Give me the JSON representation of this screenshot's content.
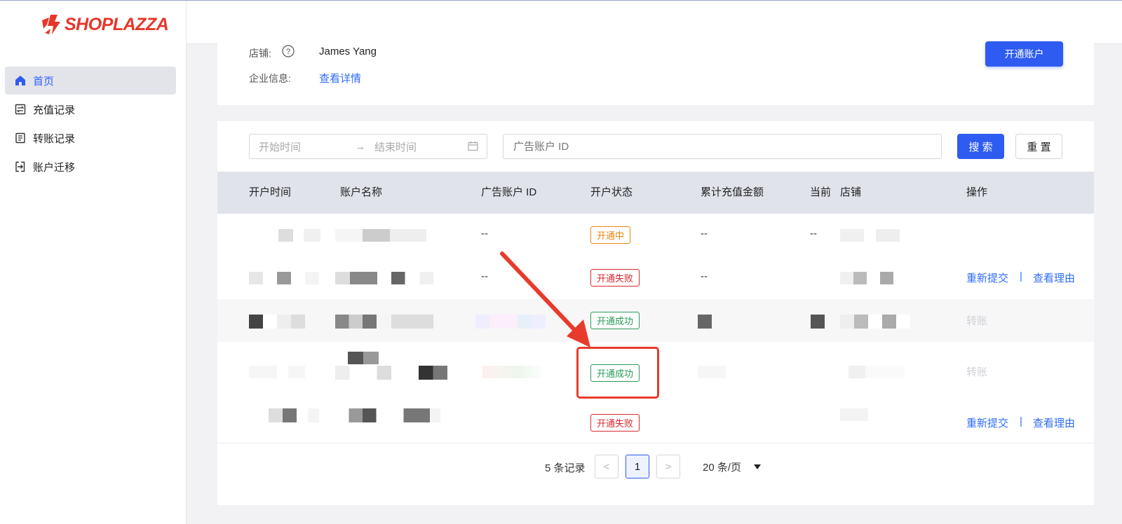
{
  "brand": {
    "name": "SHOPLAZZA",
    "color": "#e8362a"
  },
  "sidebar": {
    "items": [
      {
        "label": "首页",
        "icon": "home-icon",
        "active": true
      },
      {
        "label": "充值记录",
        "icon": "recharge-record-icon",
        "active": false
      },
      {
        "label": "转账记录",
        "icon": "transfer-record-icon",
        "active": false
      },
      {
        "label": "账户迁移",
        "icon": "account-migrate-icon",
        "active": false
      }
    ]
  },
  "info": {
    "store_label": "店铺:",
    "store_value": "James Yang",
    "company_label": "企业信息:",
    "company_link": "查看详情",
    "open_account_button": "开通账户"
  },
  "filters": {
    "start_placeholder": "开始时间",
    "arrow": "→",
    "end_placeholder": "结束时间",
    "ad_id_placeholder": "广告账户 ID",
    "search_button": "搜 索",
    "reset_button": "重 置"
  },
  "table": {
    "headers": [
      "开户时间",
      "账户名称",
      "广告账户 ID",
      "开户状态",
      "累计充值金额",
      "当前",
      "店铺",
      "操作"
    ],
    "rows": [
      {
        "ad_id": "--",
        "status": "开通中",
        "status_type": "pending",
        "total": "--",
        "current": "--",
        "actions": []
      },
      {
        "ad_id": "--",
        "status": "开通失败",
        "status_type": "fail",
        "total": "--",
        "current": "",
        "actions": [
          "重新提交",
          "查看理由"
        ]
      },
      {
        "ad_id": "",
        "status": "开通成功",
        "status_type": "ok",
        "total": "",
        "current": "",
        "actions": [
          "转账"
        ]
      },
      {
        "ad_id": "",
        "status": "开通成功",
        "status_type": "ok",
        "total": "",
        "current": "",
        "actions": [
          "转账"
        ]
      },
      {
        "ad_id": "",
        "status": "开通失败",
        "status_type": "fail",
        "total": "",
        "current": "",
        "actions": [
          "重新提交",
          "查看理由"
        ]
      }
    ],
    "action_separator": "|"
  },
  "pagination": {
    "total_text": "5 条记录",
    "prev": "<",
    "current_page": "1",
    "next": ">",
    "page_size": "20 条/页"
  },
  "colors": {
    "primary": "#2e5bf0",
    "link": "#2e6cf6",
    "annotation": "#e83b2b"
  }
}
